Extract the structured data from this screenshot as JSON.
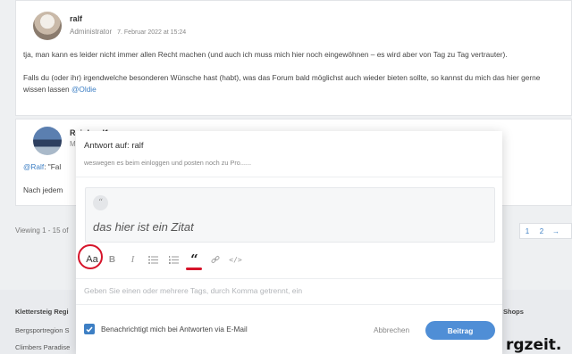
{
  "posts": [
    {
      "author": "ralf",
      "role": "Administrator",
      "date": "7. Februar 2022 at 15:24",
      "paragraph1": "tja, man kann es leider nicht immer allen Recht machen (und auch ich muss mich hier noch eingewöhnen – es wird aber von Tag zu Tag vertrauter).",
      "paragraph2": "Falls du (oder ihr) irgendwelche besonderen Wünsche hast (habt), was das Forum bald möglichst auch wieder bieten sollte, so kannst du mich das hier gerne wissen lassen",
      "mention": "@Oldie"
    },
    {
      "author": "Reinhard1",
      "role": "M",
      "mention": "@Ralf",
      "quote_snippet": ": \"Fal",
      "line2": "Nach jedem"
    }
  ],
  "viewing": "Viewing 1 - 15 of",
  "pagination": {
    "page1": "1",
    "page2": "2",
    "next": "→"
  },
  "footer": {
    "col_title": "Klettersteig Regi",
    "link1": "Bergsportregion S",
    "link2": "Climbers Paradise",
    "shops": "Shops",
    "brand": "rgzeit."
  },
  "modal": {
    "title": "Antwort auf: ralf",
    "subtitle": "weswegen es beim einloggen und posten noch zu Pro......",
    "quote_mark": "“",
    "quote_text": "das hier ist ein Zitat",
    "toolbar": {
      "aa": "Aa",
      "bold": "B",
      "italic": "I",
      "quote": "“",
      "code": "</>"
    },
    "tags_placeholder": "Geben Sie einen oder mehrere Tags, durch Komma getrennt, ein",
    "notify_label": "Benachrichtigt mich bei Antworten via E-Mail",
    "cancel": "Abbrechen",
    "submit": "Beitrag"
  },
  "colors": {
    "accent": "#4f8ed6",
    "annotation": "#d6142a",
    "link": "#3d7fc4"
  },
  "icons": [
    "text-format-icon",
    "bold-icon",
    "italic-icon",
    "bullet-list-icon",
    "numbered-list-icon",
    "blockquote-icon",
    "link-icon",
    "code-icon",
    "checkmark-icon"
  ]
}
